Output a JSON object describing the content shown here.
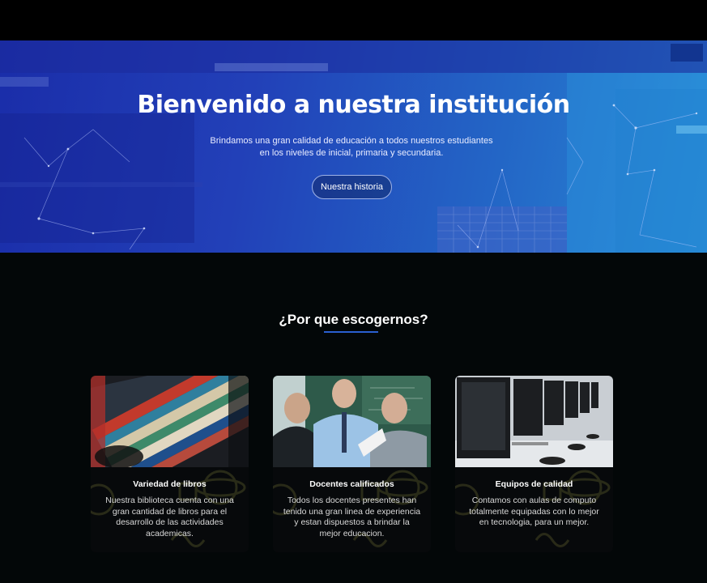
{
  "hero": {
    "title": "Bienvenido a nuestra institución",
    "subtitle_line1": "Brindamos una gran calidad de educación a todos nuestros estudiantes",
    "subtitle_line2": "en los niveles de inicial, primaria y secundaria.",
    "button_label": "Nuestra historia"
  },
  "features": {
    "title": "¿Por que escogernos?",
    "cards": [
      {
        "image": "books-photo",
        "title": "Variedad de libros",
        "text": "Nuestra biblioteca cuenta con una gran cantidad de libros para el desarrollo de las actividades academicas."
      },
      {
        "image": "teachers-photo",
        "title": "Docentes calificados",
        "text": "Todos los docentes presentes han tenido una gran linea de experiencia y estan dispuestos a brindar la mejor educacion."
      },
      {
        "image": "computers-photo",
        "title": "Equipos de calidad",
        "text": "Contamos con aulas de computo totalmente equipadas con lo mejor en tecnologia, para un mejor."
      }
    ]
  },
  "colors": {
    "hero_gradient_start": "#1a2da9",
    "hero_gradient_end": "#2a8ad6",
    "accent_underline": "#2a5fd0",
    "page_background": "#030708"
  }
}
